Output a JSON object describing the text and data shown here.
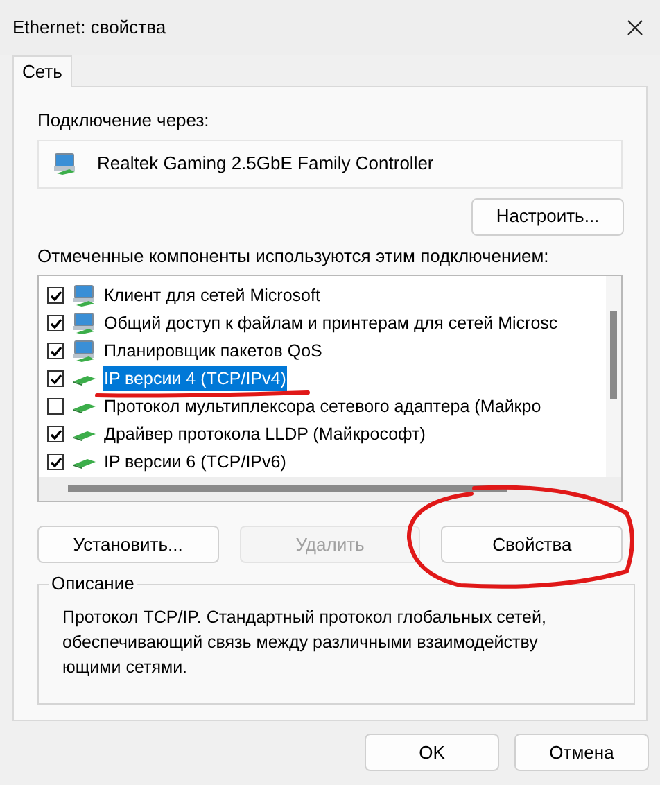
{
  "window": {
    "title": "Ethernet: свойства"
  },
  "tabs": [
    {
      "label": "Сеть",
      "selected": true
    }
  ],
  "connect_label": "Подключение через:",
  "adapter": "Realtek Gaming 2.5GbE Family Controller",
  "configure_button": "Настроить...",
  "components_label": "Отмеченные компоненты используются этим подключением:",
  "components": [
    {
      "label": "Клиент для сетей Microsoft",
      "checked": true,
      "selected": false,
      "kind": "client"
    },
    {
      "label": "Общий доступ к файлам и принтерам для сетей Microsc",
      "checked": true,
      "selected": false,
      "kind": "client"
    },
    {
      "label": "Планировщик пакетов QoS",
      "checked": true,
      "selected": false,
      "kind": "client"
    },
    {
      "label": "IP версии 4 (TCP/IPv4)",
      "checked": true,
      "selected": true,
      "kind": "protocol"
    },
    {
      "label": "Протокол мультиплексора сетевого адаптера (Майкро",
      "checked": false,
      "selected": false,
      "kind": "protocol"
    },
    {
      "label": "Драйвер протокола LLDP (Майкрософт)",
      "checked": true,
      "selected": false,
      "kind": "protocol"
    },
    {
      "label": "IP версии 6 (TCP/IPv6)",
      "checked": true,
      "selected": false,
      "kind": "protocol"
    }
  ],
  "actions": [
    {
      "label": "Установить...",
      "disabled": false
    },
    {
      "label": "Удалить",
      "disabled": true
    },
    {
      "label": "Свойства",
      "disabled": false
    }
  ],
  "description": {
    "title": "Описание",
    "lines": [
      "Протокол TCP/IP. Стандартный протокол глобальных сетей,",
      "обеспечивающий связь между различными взаимодейству",
      "ющими сетями."
    ]
  },
  "buttons": [
    "OK",
    "Отмена"
  ]
}
